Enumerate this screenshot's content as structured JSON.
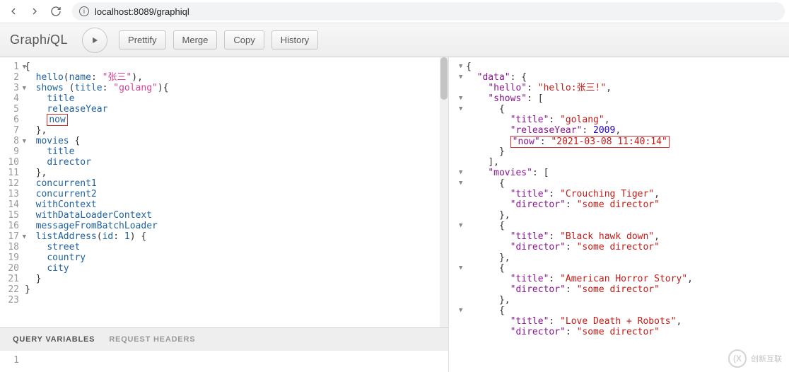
{
  "browser": {
    "url": "localhost:8089/graphiql"
  },
  "toolbar": {
    "logo_pre": "Graph",
    "logo_i": "i",
    "logo_post": "QL",
    "prettify": "Prettify",
    "merge": "Merge",
    "copy": "Copy",
    "history": "History"
  },
  "query_lines": [
    {
      "n": "1",
      "fold": true,
      "tokens": [
        {
          "t": "{",
          "c": "punc"
        }
      ]
    },
    {
      "n": "2",
      "tokens": [
        {
          "t": "  ",
          "c": ""
        },
        {
          "t": "hello",
          "c": "prop"
        },
        {
          "t": "(",
          "c": "punc"
        },
        {
          "t": "name",
          "c": "attr"
        },
        {
          "t": ": ",
          "c": "punc"
        },
        {
          "t": "\"张三\"",
          "c": "str"
        },
        {
          "t": "),",
          "c": "punc"
        }
      ]
    },
    {
      "n": "3",
      "fold": true,
      "tokens": [
        {
          "t": "  ",
          "c": ""
        },
        {
          "t": "shows",
          "c": "prop"
        },
        {
          "t": " (",
          "c": "punc"
        },
        {
          "t": "title",
          "c": "attr"
        },
        {
          "t": ": ",
          "c": "punc"
        },
        {
          "t": "\"golang\"",
          "c": "str"
        },
        {
          "t": "){",
          "c": "punc"
        }
      ]
    },
    {
      "n": "4",
      "tokens": [
        {
          "t": "    ",
          "c": ""
        },
        {
          "t": "title",
          "c": "prop"
        }
      ]
    },
    {
      "n": "5",
      "tokens": [
        {
          "t": "    ",
          "c": ""
        },
        {
          "t": "releaseYear",
          "c": "prop"
        }
      ]
    },
    {
      "n": "6",
      "tokens": [
        {
          "t": "    ",
          "c": ""
        },
        {
          "t": "now",
          "c": "prop",
          "box": true
        }
      ]
    },
    {
      "n": "7",
      "tokens": [
        {
          "t": "  },",
          "c": "punc"
        }
      ]
    },
    {
      "n": "8",
      "fold": true,
      "tokens": [
        {
          "t": "  ",
          "c": ""
        },
        {
          "t": "movies",
          "c": "prop"
        },
        {
          "t": " {",
          "c": "punc"
        }
      ]
    },
    {
      "n": "9",
      "tokens": [
        {
          "t": "    ",
          "c": ""
        },
        {
          "t": "title",
          "c": "prop"
        }
      ]
    },
    {
      "n": "10",
      "tokens": [
        {
          "t": "    ",
          "c": ""
        },
        {
          "t": "director",
          "c": "prop"
        }
      ]
    },
    {
      "n": "11",
      "tokens": [
        {
          "t": "  },",
          "c": "punc"
        }
      ]
    },
    {
      "n": "12",
      "tokens": [
        {
          "t": "  ",
          "c": ""
        },
        {
          "t": "concurrent1",
          "c": "prop"
        }
      ]
    },
    {
      "n": "13",
      "tokens": [
        {
          "t": "  ",
          "c": ""
        },
        {
          "t": "concurrent2",
          "c": "prop"
        }
      ]
    },
    {
      "n": "14",
      "tokens": [
        {
          "t": "  ",
          "c": ""
        },
        {
          "t": "withContext",
          "c": "prop"
        }
      ]
    },
    {
      "n": "15",
      "tokens": [
        {
          "t": "  ",
          "c": ""
        },
        {
          "t": "withDataLoaderContext",
          "c": "prop"
        }
      ]
    },
    {
      "n": "16",
      "tokens": [
        {
          "t": "  ",
          "c": ""
        },
        {
          "t": "messageFromBatchLoader",
          "c": "prop"
        }
      ]
    },
    {
      "n": "17",
      "fold": true,
      "tokens": [
        {
          "t": "  ",
          "c": ""
        },
        {
          "t": "listAddress",
          "c": "prop"
        },
        {
          "t": "(",
          "c": "punc"
        },
        {
          "t": "id",
          "c": "attr"
        },
        {
          "t": ": ",
          "c": "punc"
        },
        {
          "t": "1",
          "c": "prop"
        },
        {
          "t": ") {",
          "c": "punc"
        }
      ]
    },
    {
      "n": "18",
      "tokens": [
        {
          "t": "    ",
          "c": ""
        },
        {
          "t": "street",
          "c": "prop"
        }
      ]
    },
    {
      "n": "19",
      "tokens": [
        {
          "t": "    ",
          "c": ""
        },
        {
          "t": "country",
          "c": "prop"
        }
      ]
    },
    {
      "n": "20",
      "tokens": [
        {
          "t": "    ",
          "c": ""
        },
        {
          "t": "city",
          "c": "prop"
        }
      ]
    },
    {
      "n": "21",
      "tokens": [
        {
          "t": "  }",
          "c": "punc"
        }
      ]
    },
    {
      "n": "22",
      "tokens": [
        {
          "t": "}",
          "c": "punc"
        }
      ]
    },
    {
      "n": "23",
      "tokens": []
    }
  ],
  "tabs": {
    "vars": "Query Variables",
    "headers": "Request Headers"
  },
  "vars_gutter": "1",
  "result_lines": [
    {
      "fold": true,
      "indent": 0,
      "tokens": [
        {
          "t": "{",
          "c": "punc"
        }
      ]
    },
    {
      "fold": true,
      "indent": 1,
      "tokens": [
        {
          "t": "\"data\"",
          "c": "key"
        },
        {
          "t": ": {",
          "c": "punc"
        }
      ]
    },
    {
      "indent": 2,
      "tokens": [
        {
          "t": "\"hello\"",
          "c": "key"
        },
        {
          "t": ": ",
          "c": "punc"
        },
        {
          "t": "\"hello:张三!\"",
          "c": "str2"
        },
        {
          "t": ",",
          "c": "punc"
        }
      ]
    },
    {
      "fold": true,
      "indent": 2,
      "tokens": [
        {
          "t": "\"shows\"",
          "c": "key"
        },
        {
          "t": ": [",
          "c": "punc"
        }
      ]
    },
    {
      "fold": true,
      "indent": 3,
      "tokens": [
        {
          "t": "{",
          "c": "punc"
        }
      ]
    },
    {
      "indent": 4,
      "tokens": [
        {
          "t": "\"title\"",
          "c": "key"
        },
        {
          "t": ": ",
          "c": "punc"
        },
        {
          "t": "\"golang\"",
          "c": "str2"
        },
        {
          "t": ",",
          "c": "punc"
        }
      ]
    },
    {
      "indent": 4,
      "tokens": [
        {
          "t": "\"releaseYear\"",
          "c": "key"
        },
        {
          "t": ": ",
          "c": "punc"
        },
        {
          "t": "2009",
          "c": "num"
        },
        {
          "t": ",",
          "c": "punc"
        }
      ]
    },
    {
      "indent": 4,
      "box": true,
      "tokens": [
        {
          "t": "\"now\"",
          "c": "key"
        },
        {
          "t": ": ",
          "c": "punc"
        },
        {
          "t": "\"2021-03-08 11:40:14\"",
          "c": "str2"
        }
      ]
    },
    {
      "indent": 3,
      "tokens": [
        {
          "t": "}",
          "c": "punc"
        }
      ]
    },
    {
      "indent": 2,
      "tokens": [
        {
          "t": "],",
          "c": "punc"
        }
      ]
    },
    {
      "fold": true,
      "indent": 2,
      "tokens": [
        {
          "t": "\"movies\"",
          "c": "key"
        },
        {
          "t": ": [",
          "c": "punc"
        }
      ]
    },
    {
      "fold": true,
      "indent": 3,
      "tokens": [
        {
          "t": "{",
          "c": "punc"
        }
      ]
    },
    {
      "indent": 4,
      "tokens": [
        {
          "t": "\"title\"",
          "c": "key"
        },
        {
          "t": ": ",
          "c": "punc"
        },
        {
          "t": "\"Crouching Tiger\"",
          "c": "str2"
        },
        {
          "t": ",",
          "c": "punc"
        }
      ]
    },
    {
      "indent": 4,
      "tokens": [
        {
          "t": "\"director\"",
          "c": "key"
        },
        {
          "t": ": ",
          "c": "punc"
        },
        {
          "t": "\"some director\"",
          "c": "str2"
        }
      ]
    },
    {
      "indent": 3,
      "tokens": [
        {
          "t": "},",
          "c": "punc"
        }
      ]
    },
    {
      "fold": true,
      "indent": 3,
      "tokens": [
        {
          "t": "{",
          "c": "punc"
        }
      ]
    },
    {
      "indent": 4,
      "tokens": [
        {
          "t": "\"title\"",
          "c": "key"
        },
        {
          "t": ": ",
          "c": "punc"
        },
        {
          "t": "\"Black hawk down\"",
          "c": "str2"
        },
        {
          "t": ",",
          "c": "punc"
        }
      ]
    },
    {
      "indent": 4,
      "tokens": [
        {
          "t": "\"director\"",
          "c": "key"
        },
        {
          "t": ": ",
          "c": "punc"
        },
        {
          "t": "\"some director\"",
          "c": "str2"
        }
      ]
    },
    {
      "indent": 3,
      "tokens": [
        {
          "t": "},",
          "c": "punc"
        }
      ]
    },
    {
      "fold": true,
      "indent": 3,
      "tokens": [
        {
          "t": "{",
          "c": "punc"
        }
      ]
    },
    {
      "indent": 4,
      "tokens": [
        {
          "t": "\"title\"",
          "c": "key"
        },
        {
          "t": ": ",
          "c": "punc"
        },
        {
          "t": "\"American Horror Story\"",
          "c": "str2"
        },
        {
          "t": ",",
          "c": "punc"
        }
      ]
    },
    {
      "indent": 4,
      "tokens": [
        {
          "t": "\"director\"",
          "c": "key"
        },
        {
          "t": ": ",
          "c": "punc"
        },
        {
          "t": "\"some director\"",
          "c": "str2"
        }
      ]
    },
    {
      "indent": 3,
      "tokens": [
        {
          "t": "},",
          "c": "punc"
        }
      ]
    },
    {
      "fold": true,
      "indent": 3,
      "tokens": [
        {
          "t": "{",
          "c": "punc"
        }
      ]
    },
    {
      "indent": 4,
      "tokens": [
        {
          "t": "\"title\"",
          "c": "key"
        },
        {
          "t": ": ",
          "c": "punc"
        },
        {
          "t": "\"Love Death + Robots\"",
          "c": "str2"
        },
        {
          "t": ",",
          "c": "punc"
        }
      ]
    },
    {
      "indent": 4,
      "tokens": [
        {
          "t": "\"director\"",
          "c": "key"
        },
        {
          "t": ": ",
          "c": "punc"
        },
        {
          "t": "\"some director\"",
          "c": "str2"
        }
      ]
    }
  ],
  "watermark": {
    "logo": "(X",
    "text": "创新互联"
  }
}
